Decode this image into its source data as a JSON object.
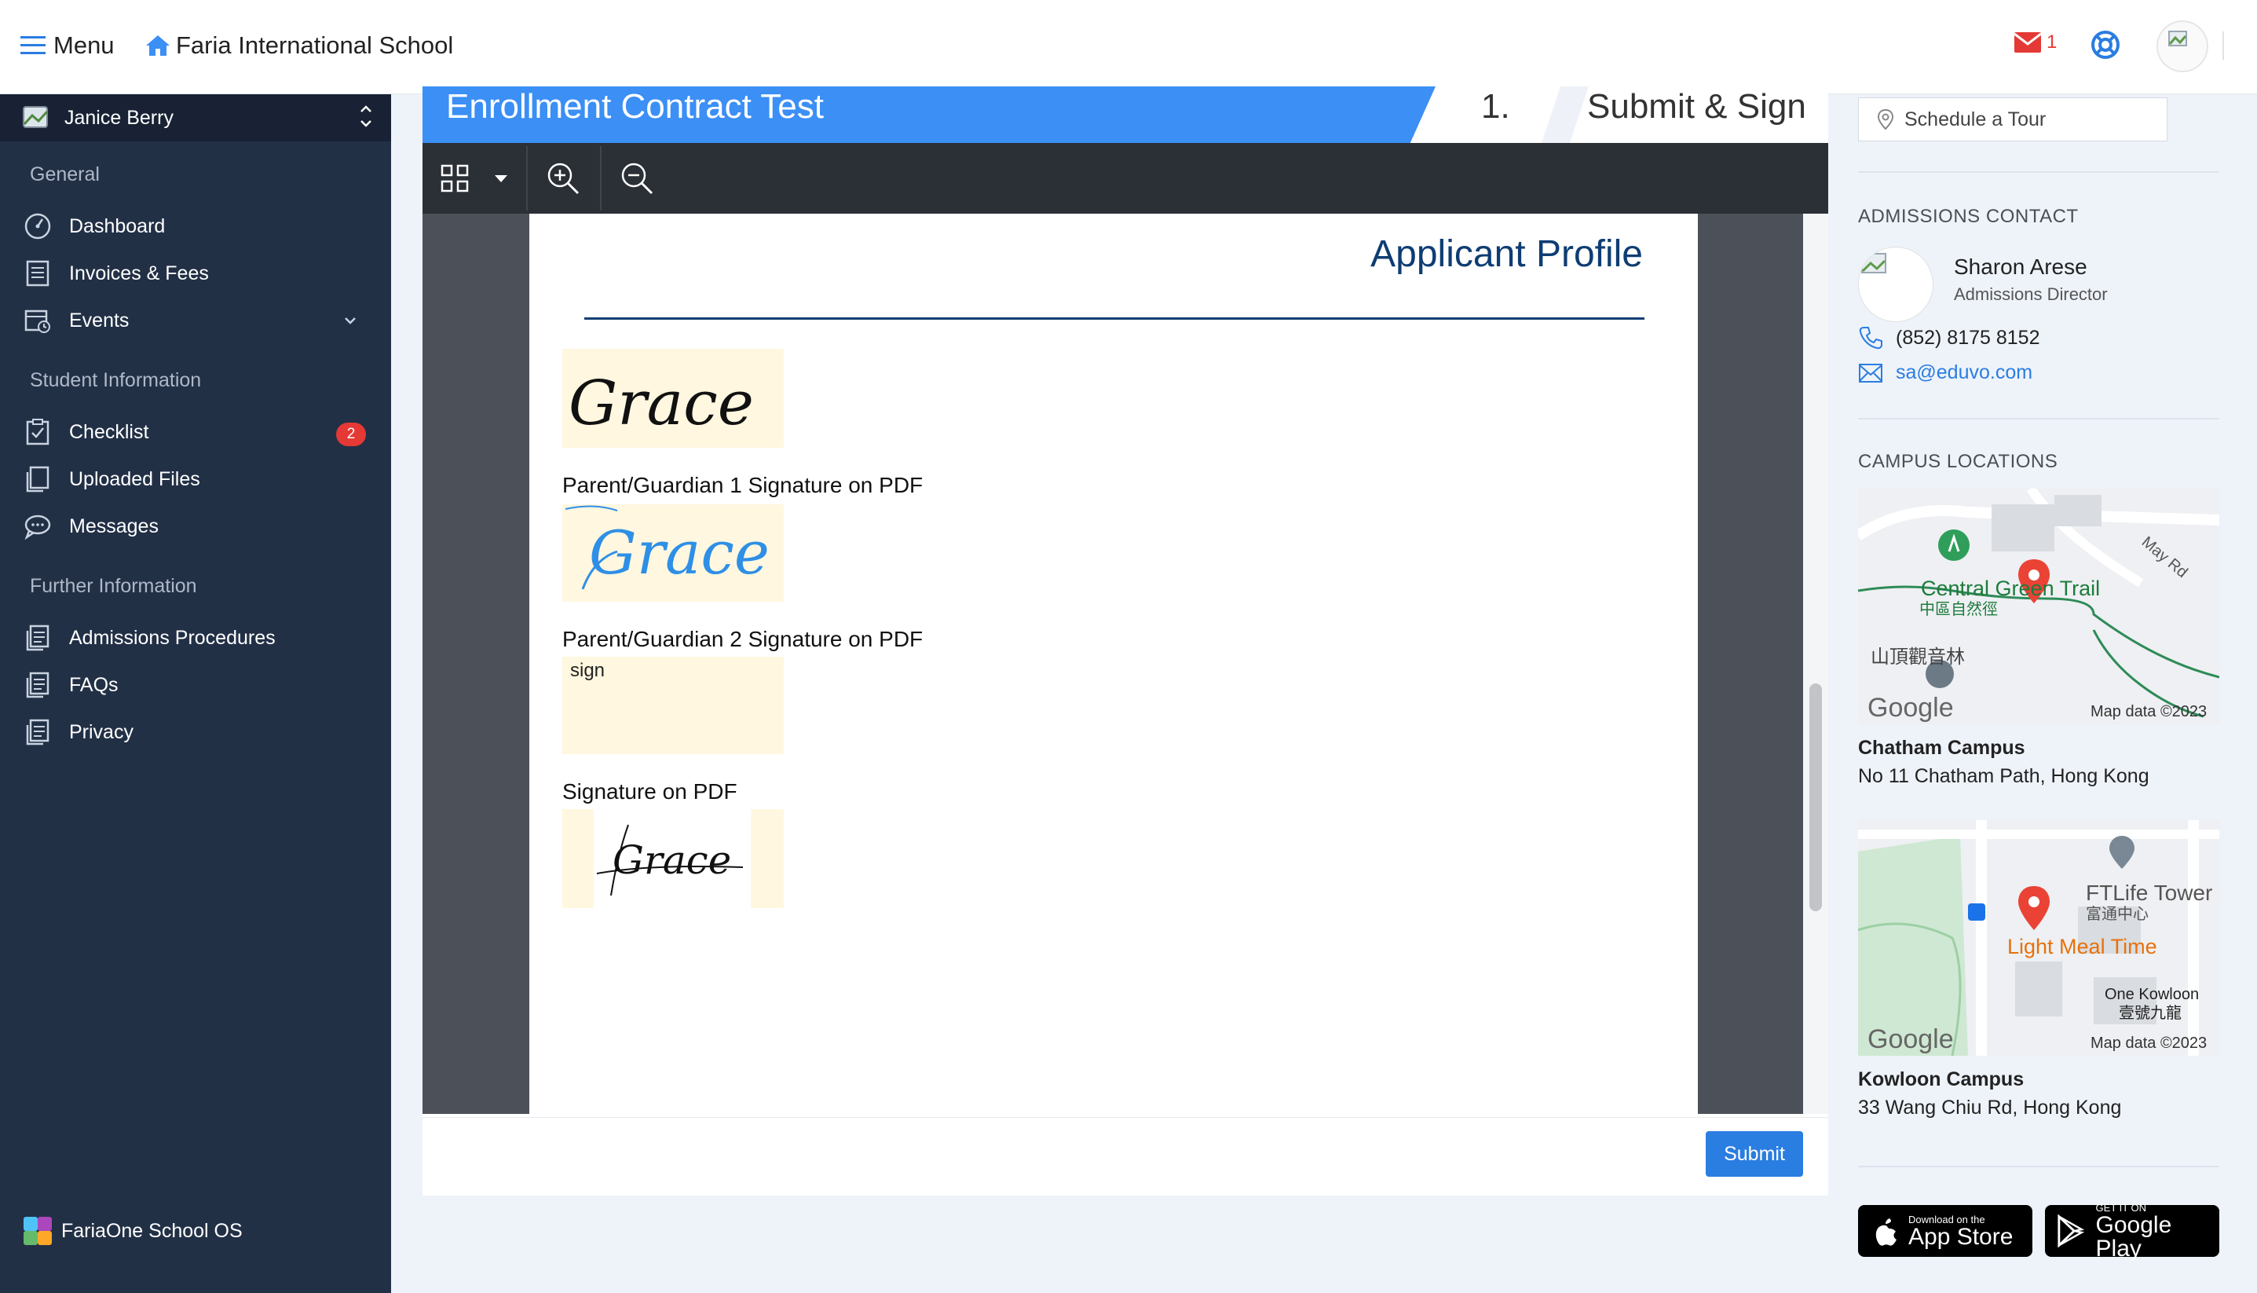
{
  "header": {
    "menu_label": "Menu",
    "school_name": "Faria International School",
    "mail_count": "1"
  },
  "sidebar": {
    "user_name": "Janice Berry",
    "sections": [
      "General",
      "Student Information",
      "Further Information"
    ],
    "items": [
      {
        "label": "Dashboard",
        "icon": "dashboard-icon"
      },
      {
        "label": "Invoices & Fees",
        "icon": "invoice-icon"
      },
      {
        "label": "Events",
        "icon": "calendar-icon"
      },
      {
        "label": "Checklist",
        "icon": "checklist-icon",
        "badge": "2"
      },
      {
        "label": "Uploaded Files",
        "icon": "files-icon"
      },
      {
        "label": "Messages",
        "icon": "messages-icon"
      },
      {
        "label": "Admissions Procedures",
        "icon": "document-icon"
      },
      {
        "label": "FAQs",
        "icon": "document-icon"
      },
      {
        "label": "Privacy",
        "icon": "document-icon"
      }
    ],
    "brand_label": "FariaOne School OS"
  },
  "form": {
    "title": "Enrollment Contract Test",
    "step_number": "1.",
    "step_label": "Submit & Sign"
  },
  "pdf": {
    "page_title": "Applicant Profile",
    "fields": [
      {
        "label": ""
      },
      {
        "label": "Parent/Guardian 1 Signature on PDF"
      },
      {
        "label": "Parent/Guardian 2 Signature on PDF",
        "placeholder": "sign"
      },
      {
        "label": "Signature on PDF"
      }
    ],
    "signature_text_1": "Grace",
    "signature_text_2": "Grace",
    "signature_text_4": "Grace"
  },
  "footer": {
    "submit_label": "Submit"
  },
  "right_panel": {
    "tour_label": "Schedule a Tour",
    "contact_section": "ADMISSIONS CONTACT",
    "contact_name": "Sharon Arese",
    "contact_role": "Admissions Director",
    "contact_phone": "(852) 8175 8152",
    "contact_email": "sa@eduvo.com",
    "locations_section": "CAMPUS LOCATIONS",
    "maps": [
      {
        "labels": [
          "May Rd",
          "Central Green Trail",
          "中區自然徑",
          "山頂觀音林"
        ],
        "google": "Google",
        "attribution": "Map data ©2023"
      },
      {
        "labels": [
          "FTLife Tower",
          "富通中心",
          "Light Meal Time",
          "One Kowloon",
          "壹號九龍"
        ],
        "google": "Google",
        "attribution": "Map data ©2023"
      }
    ],
    "campuses": [
      {
        "name": "Chatham Campus",
        "address": "No 11 Chatham Path, Hong Kong"
      },
      {
        "name": "Kowloon Campus",
        "address": "33 Wang Chiu Rd, Hong Kong"
      }
    ],
    "app_store": {
      "small": "Download on the",
      "big": "App Store"
    },
    "google_play": {
      "small": "GET IT ON",
      "big": "Google Play"
    }
  },
  "colors": {
    "primary_blue": "#3b8ff5",
    "sidebar_bg": "#223046",
    "badge_red": "#e53935",
    "link_blue": "#2a7de1",
    "signature_bg": "#fff7e0"
  }
}
